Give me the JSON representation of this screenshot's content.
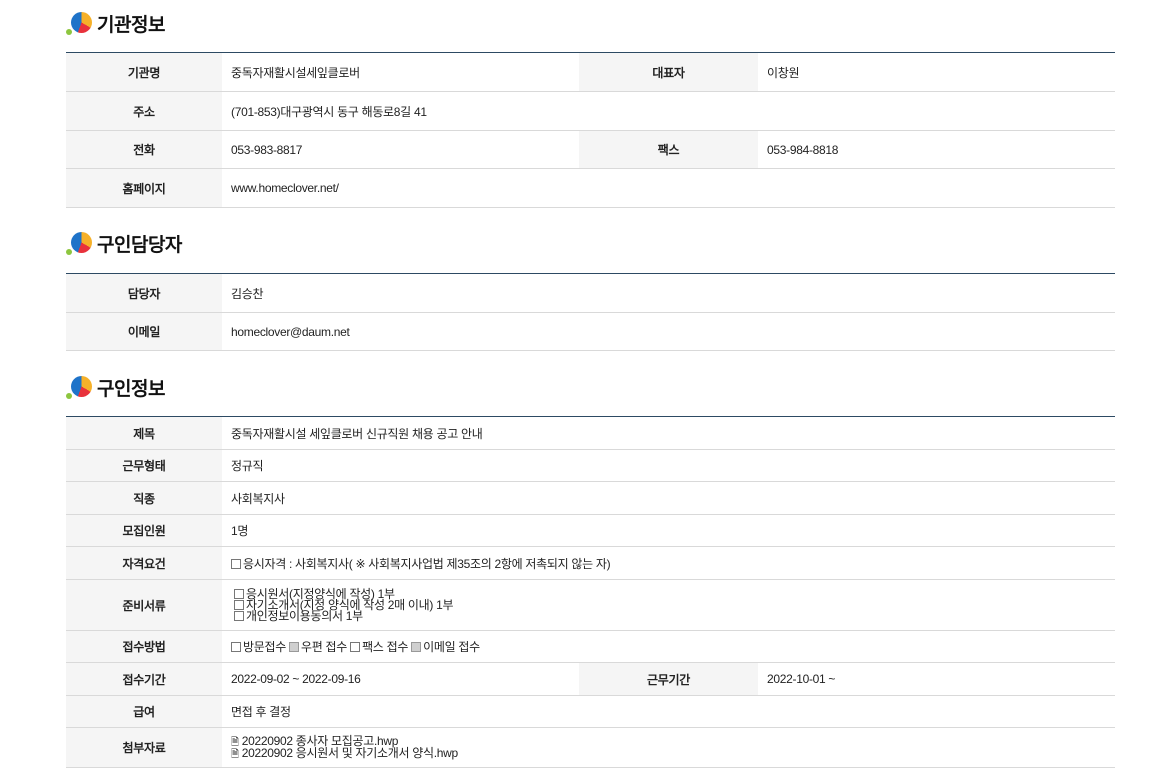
{
  "sections": [
    {
      "title": "기관정보"
    },
    {
      "title": "구인담당자"
    },
    {
      "title": "구인정보"
    }
  ],
  "agency": {
    "name_label": "기관명",
    "name": "중독자재활시설세잎클로버",
    "rep_label": "대표자",
    "rep": "이창원",
    "address_label": "주소",
    "address": "(701-853)대구광역시 동구 해동로8길 41",
    "phone_label": "전화",
    "phone": "053-983-8817",
    "fax_label": "팩스",
    "fax": "053-984-8818",
    "homepage_label": "홈페이지",
    "homepage": "www.homeclover.net/"
  },
  "contact": {
    "person_label": "담당자",
    "person": "김승찬",
    "email_label": "이메일",
    "email": "homeclover@daum.net"
  },
  "job": {
    "title_label": "제목",
    "title": "중독자재활시설 세잎클로버 신규직원 채용 공고 안내",
    "type_label": "근무형태",
    "type": "정규직",
    "occupation_label": "직종",
    "occupation": "사회복지사",
    "count_label": "모집인원",
    "count": "1명",
    "qual_label": "자격요건",
    "qual": "응시자격 : 사회복지사( ※ 사회복지사업법 제35조의 2항에 저촉되지 않는 자)",
    "docs_label": "준비서류",
    "docs": [
      "응시원서(지정양식에 작성) 1부",
      "자기소개서(지정 양식에 작성 2매 이내) 1부",
      "개인정보이용동의서 1부"
    ],
    "method_label": "접수방법",
    "methods": [
      {
        "label": "방문접수",
        "checked": false
      },
      {
        "label": "우편 접수",
        "checked": true
      },
      {
        "label": "팩스 접수",
        "checked": false
      },
      {
        "label": "이메일 접수",
        "checked": true
      }
    ],
    "period_label": "접수기간",
    "period": "2022-09-02 ~ 2022-09-16",
    "work_period_label": "근무기간",
    "work_period": "2022-10-01 ~",
    "salary_label": "급여",
    "salary": "면접 후 결정",
    "attach_label": "첨부자료",
    "attachments": [
      "20220902 종사자 모집공고.hwp",
      "20220902 응시원서 및 자기소개서 양식.hwp"
    ]
  }
}
